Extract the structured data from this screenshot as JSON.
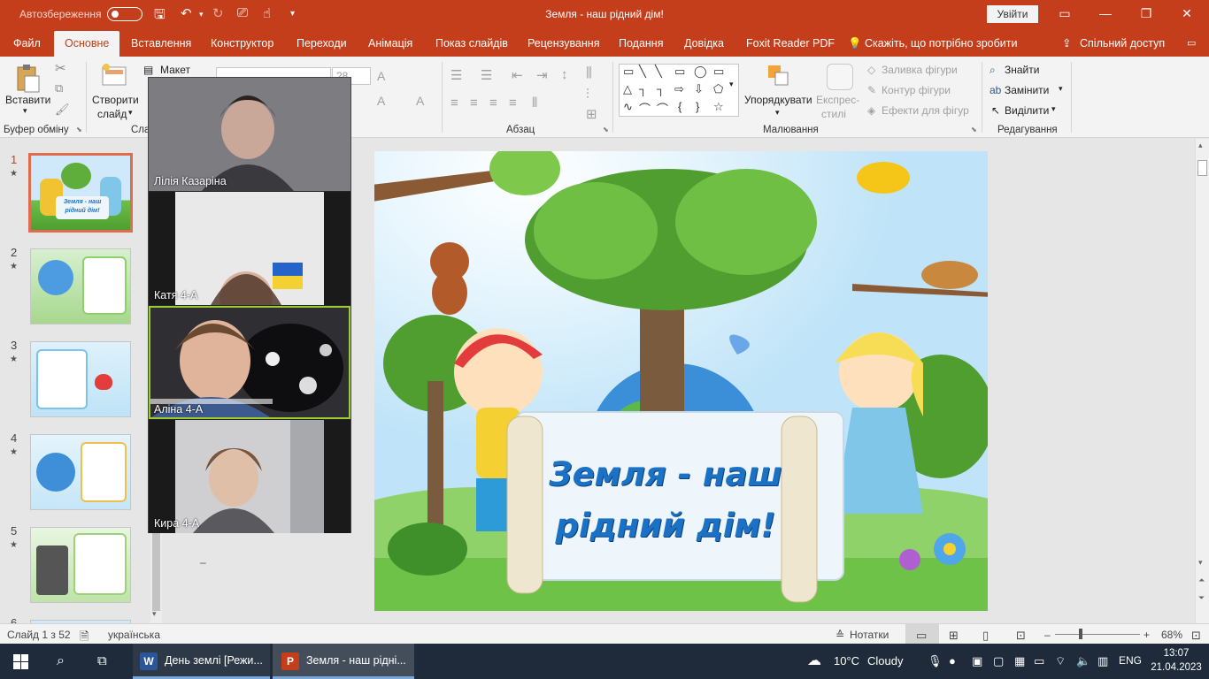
{
  "titlebar": {
    "autosave_label": "Автозбереження",
    "doc_title": "Земля - наш рідний дім!",
    "signin_label": "Увійти"
  },
  "tabs": [
    {
      "label": "Файл"
    },
    {
      "label": "Основне"
    },
    {
      "label": "Вставлення"
    },
    {
      "label": "Конструктор"
    },
    {
      "label": "Переходи"
    },
    {
      "label": "Анімація"
    },
    {
      "label": "Показ слайдів"
    },
    {
      "label": "Рецензування"
    },
    {
      "label": "Подання"
    },
    {
      "label": "Довідка"
    },
    {
      "label": "Foxit Reader PDF"
    },
    {
      "label": "Скажіть, що потрібно зробити"
    },
    {
      "label": "Спільний доступ"
    }
  ],
  "ribbon": {
    "paste_label": "Вставити",
    "clipboard_group": "Буфер обміну",
    "new_slide_label": "Створити",
    "new_slide_label2": "слайд",
    "layout_label": "Макет",
    "slides_group_partial": "Сла",
    "font_size": "28",
    "paragraph_group": "Абзац",
    "arrange_label": "Упорядкувати",
    "express_styles_label": "Експрес-",
    "express_styles_label2": "стилі",
    "shape_fill_label": "Заливка фігури",
    "shape_outline_label": "Контур фігури",
    "shape_effects_label": "Ефекти для фігур",
    "drawing_group": "Малювання",
    "find_label": "Знайти",
    "replace_label": "Замінити",
    "select_label": "Виділити",
    "editing_group": "Редагування"
  },
  "thumbnails": [
    {
      "number": "1",
      "star": "★",
      "title": "Земля - наш рідний дім!"
    },
    {
      "number": "2",
      "star": "★"
    },
    {
      "number": "3",
      "star": "★"
    },
    {
      "number": "4",
      "star": "★"
    },
    {
      "number": "5",
      "star": "★"
    },
    {
      "number": "6"
    }
  ],
  "slide": {
    "title_line1": "Земля - наш",
    "title_line2": "рідний дім!"
  },
  "video": {
    "participants": [
      {
        "name": "Лілія Казаріна"
      },
      {
        "name": "Катя  4-А"
      },
      {
        "name": "Аліна 4-А"
      },
      {
        "name": "Кира 4-А"
      }
    ]
  },
  "statusbar": {
    "slide_counter": "Слайд 1 з 52",
    "language": "українська",
    "notes_label": "Нотатки",
    "zoom": "68%"
  },
  "taskbar": {
    "word_app": "День землі [Режи...",
    "ppt_app": "Земля - наш рідні...",
    "weather_temp": "10°C",
    "weather_desc": "Cloudy",
    "lang": "ENG",
    "time": "13:07",
    "date": "21.04.2023"
  },
  "colors": {
    "accent": "#c43e1c",
    "slide_title": "#1b72c4"
  }
}
